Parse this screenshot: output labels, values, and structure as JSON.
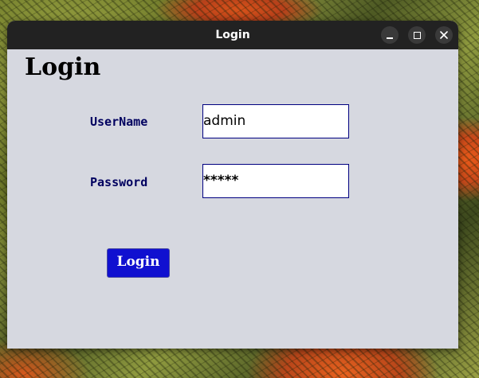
{
  "window": {
    "title": "Login",
    "controls": {
      "minimize": "minimize",
      "maximize": "maximize",
      "close": "close"
    }
  },
  "form": {
    "heading": "Login",
    "username_label": "UserName",
    "username_value": "admin",
    "password_label": "Password",
    "password_value": "*****",
    "submit_label": "Login"
  },
  "colors": {
    "titlebar": "#222222",
    "window_bg": "#d6d8e0",
    "label_text": "#00005f",
    "button_bg": "#1010d0",
    "input_border": "#000080"
  },
  "icons": [
    "minimize-icon",
    "maximize-icon",
    "close-icon"
  ]
}
